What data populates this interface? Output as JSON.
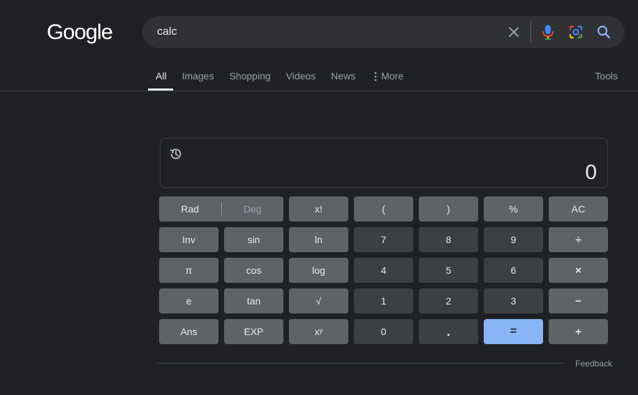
{
  "logo": {
    "text": "Google"
  },
  "search": {
    "value": "calc"
  },
  "tabs": [
    {
      "label": "All",
      "active": true
    },
    {
      "label": "Images"
    },
    {
      "label": "Shopping"
    },
    {
      "label": "Videos"
    },
    {
      "label": "News"
    },
    {
      "label": "More"
    }
  ],
  "tools": "Tools",
  "calculator": {
    "display": "0",
    "keys": {
      "rad": "Rad",
      "deg": "Deg",
      "fact": "x!",
      "lparen": "(",
      "rparen": ")",
      "percent": "%",
      "ac": "AC",
      "inv": "Inv",
      "sin": "sin",
      "ln": "ln",
      "k7": "7",
      "k8": "8",
      "k9": "9",
      "div": "÷",
      "pi": "π",
      "cos": "cos",
      "log": "log",
      "k4": "4",
      "k5": "5",
      "k6": "6",
      "mul": "×",
      "e": "e",
      "tan": "tan",
      "sqrt": "√",
      "k1": "1",
      "k2": "2",
      "k3": "3",
      "minus": "−",
      "ans": "Ans",
      "exp": "EXP",
      "pow": "xʸ",
      "k0": "0",
      "dot": ".",
      "eq": "=",
      "plus": "+"
    }
  },
  "feedback": "Feedback",
  "colors": {
    "background": "#202124",
    "key_function": "#5f6368",
    "key_number": "#3c4043",
    "key_equals": "#8ab4f8",
    "text": "#e8eaed",
    "muted": "#9aa0a6"
  }
}
